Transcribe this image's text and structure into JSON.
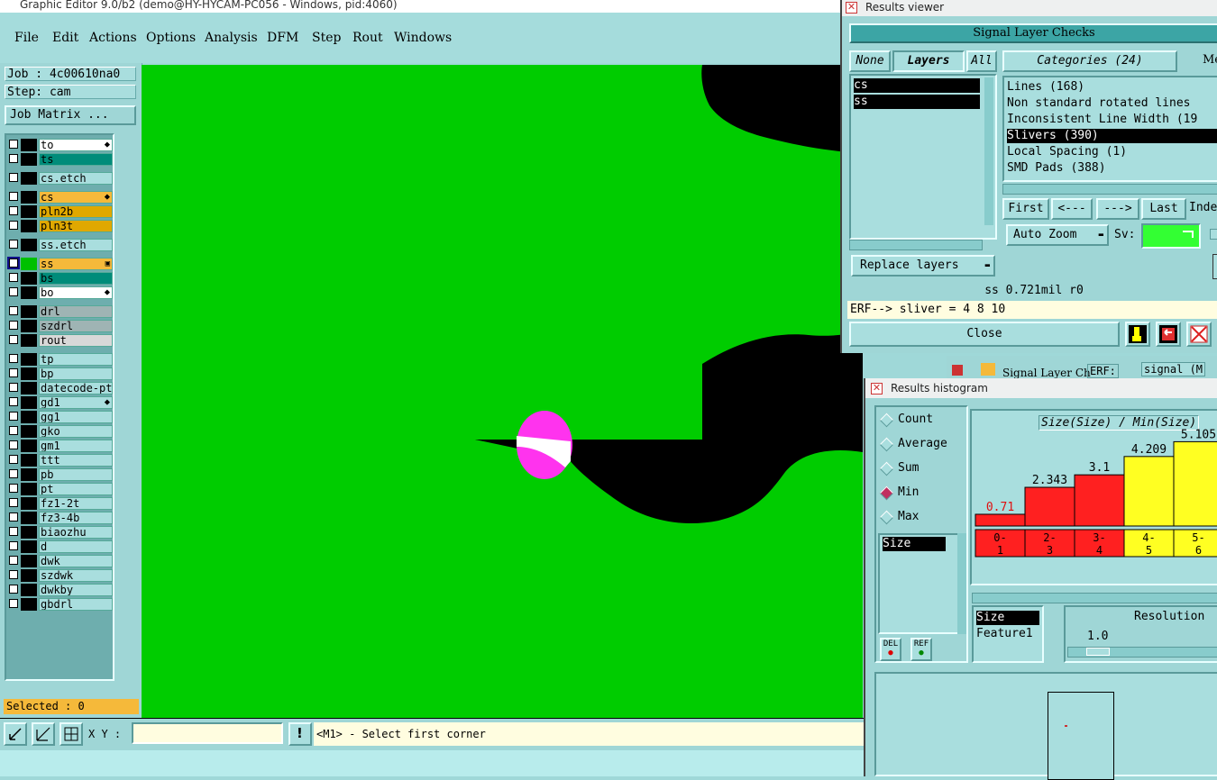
{
  "main_window": {
    "title": "Graphic Editor 9.0/b2 (demo@HY-HYCAM-PC056 - Windows, pid:4060)",
    "menu": [
      "File",
      "Edit",
      "Actions",
      "Options",
      "Analysis",
      "DFM",
      "Step",
      "Rout",
      "Windows"
    ]
  },
  "left_panel": {
    "job": "Job : 4c00610na0",
    "step": "Step: cam",
    "job_matrix": "Job Matrix ...",
    "layers": [
      {
        "name": "to",
        "bg": "#ffffff",
        "flag": "⬥"
      },
      {
        "name": "ts",
        "bg": "#008c7a",
        "flag": ""
      },
      {
        "name": "cs.etch",
        "bg": "#a9dede",
        "flag": "",
        "gap": true
      },
      {
        "name": "cs",
        "bg": "#f5b93a",
        "flag": "⬥",
        "gap": true
      },
      {
        "name": "pln2b",
        "bg": "#e0a800",
        "flag": ""
      },
      {
        "name": "pln3t",
        "bg": "#e0a800",
        "flag": ""
      },
      {
        "name": "ss.etch",
        "bg": "#a9dede",
        "flag": "",
        "gap": true
      },
      {
        "name": "ss",
        "bg": "#f5b93a",
        "flag": "▣",
        "gap": true,
        "selected": true
      },
      {
        "name": "bs",
        "bg": "#008c7a",
        "flag": ""
      },
      {
        "name": "bo",
        "bg": "#ffffff",
        "flag": "⬥"
      },
      {
        "name": "drl",
        "bg": "#9fb4b4",
        "flag": "",
        "gap": true
      },
      {
        "name": "szdrl",
        "bg": "#9fb4b4",
        "flag": ""
      },
      {
        "name": "rout",
        "bg": "#d8d8d8",
        "flag": ""
      },
      {
        "name": "tp",
        "bg": "#a9dede",
        "flag": "",
        "gap": true
      },
      {
        "name": "bp",
        "bg": "#a9dede",
        "flag": ""
      },
      {
        "name": "datecode-ptc",
        "bg": "#a9dede",
        "flag": ""
      },
      {
        "name": "gd1",
        "bg": "#a9dede",
        "flag": "⬥"
      },
      {
        "name": "gg1",
        "bg": "#a9dede",
        "flag": ""
      },
      {
        "name": "gko",
        "bg": "#a9dede",
        "flag": ""
      },
      {
        "name": "gm1",
        "bg": "#a9dede",
        "flag": ""
      },
      {
        "name": "ttt",
        "bg": "#a9dede",
        "flag": ""
      },
      {
        "name": "pb",
        "bg": "#a9dede",
        "flag": ""
      },
      {
        "name": "pt",
        "bg": "#a9dede",
        "flag": ""
      },
      {
        "name": "fz1-2t",
        "bg": "#a9dede",
        "flag": ""
      },
      {
        "name": "fz3-4b",
        "bg": "#a9dede",
        "flag": ""
      },
      {
        "name": "biaozhu",
        "bg": "#a9dede",
        "flag": ""
      },
      {
        "name": "d",
        "bg": "#a9dede",
        "flag": ""
      },
      {
        "name": "dwk",
        "bg": "#a9dede",
        "flag": ""
      },
      {
        "name": "szdwk",
        "bg": "#a9dede",
        "flag": ""
      },
      {
        "name": "dwkby",
        "bg": "#a9dede",
        "flag": ""
      },
      {
        "name": "gbdrl",
        "bg": "#a9dede",
        "flag": ""
      }
    ],
    "selected": "Selected : 0"
  },
  "status_bar": {
    "xy_label": "X Y :",
    "xy_value": "",
    "message": "<M1> - Select first corner"
  },
  "results_viewer": {
    "title": "Results viewer",
    "header": "Signal Layer Checks",
    "none_label": "None",
    "layers_label": "Layers",
    "all_label": "All",
    "categories_label": "Categories (24)",
    "me_label": "Me",
    "layers": [
      "cs",
      "ss"
    ],
    "categories": [
      "Lines (168)",
      "Non standard rotated lines",
      "Inconsistent Line Width (19",
      "Slivers (390)",
      "Local Spacing (1)",
      "SMD Pads (388)"
    ],
    "selected_category_index": 3,
    "first": "First",
    "prev": "<---",
    "next": "--->",
    "last": "Last",
    "index": "Index",
    "auto_zoom": "Auto Zoom",
    "sv": "Sv:",
    "replace_layers": "Replace layers",
    "status": "ss 0.721mil  r0",
    "erf": "ERF--> sliver = 4 8 10",
    "close": "Close",
    "behind_text_1": "Signal Layer Ch",
    "behind_text_2": "ERF:",
    "behind_text_3": "signal (M"
  },
  "results_histogram": {
    "title": "Results histogram",
    "modes": [
      "Count",
      "Average",
      "Sum",
      "Min",
      "Max"
    ],
    "selected_mode": "Min",
    "size_item": "Size",
    "del": "DEL",
    "ref": "REF",
    "chart_title": "Size(Size) / Min(Size)",
    "attr_list": [
      "Size",
      "Feature1"
    ],
    "resolution_label": "Resolution",
    "resolution_value": "1.0"
  },
  "chart_data": {
    "type": "bar",
    "title": "Size(Size) / Min(Size)",
    "categories": [
      "0-1",
      "2-3",
      "3-4",
      "4-5",
      "5-6"
    ],
    "values": [
      0.71,
      2.343,
      3.1,
      4.209,
      5.105
    ],
    "value_labels": [
      "0.71",
      "2.343",
      "3.1",
      "4.209",
      "5.105"
    ],
    "bar_colors": [
      "#ff2020",
      "#ff2020",
      "#ff2020",
      "#ffff22",
      "#ffff22"
    ],
    "label_colors": [
      "#e01010",
      "#000000",
      "#000000",
      "#000000",
      "#000000"
    ]
  }
}
